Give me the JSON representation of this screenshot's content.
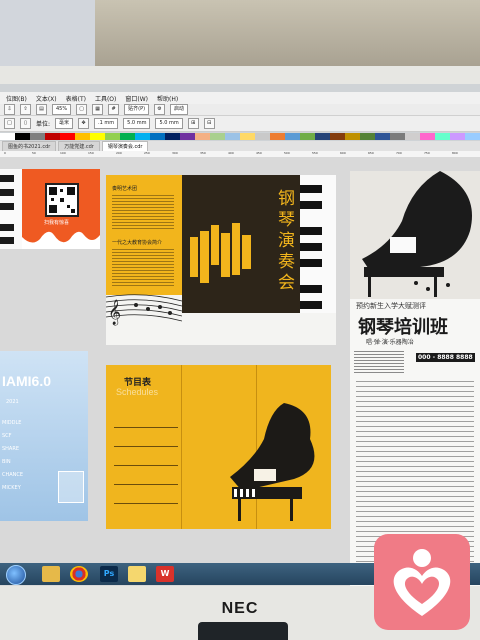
{
  "menu": {
    "items": [
      "位图(B)",
      "文本(X)",
      "表格(T)",
      "工具(O)",
      "窗口(W)",
      "帮助(H)"
    ]
  },
  "toolbar": {
    "zoom": "45%",
    "snap": "贴齐(P)",
    "launch": "启动"
  },
  "propbar": {
    "units_label": "单位:",
    "units": "毫米",
    "nudge": ".1 mm",
    "dup_x": "5.0 mm",
    "dup_y": "5.0 mm"
  },
  "tabs": [
    "图鱼的书2021.cdr",
    "万能党建.cdr",
    "钢琴演奏会.cdr"
  ],
  "active_tab": 2,
  "ruler_ticks": [
    "0",
    "50",
    "100",
    "150",
    "200",
    "250",
    "300",
    "350",
    "400",
    "450",
    "500",
    "550",
    "600",
    "650",
    "700",
    "750",
    "800"
  ],
  "left_panel": {
    "qr_label": "扫我有惊喜",
    "brand": "IAMI6.0",
    "brand_year": "2021",
    "features": [
      "MIDDLE",
      "SCF",
      "SHARE",
      "BIN",
      "CHANCE",
      "MICKEY"
    ]
  },
  "brochure_outer": {
    "intro_heading": "奏明艺术团",
    "music_heading": "一代之大教育协会简介",
    "title": "钢琴演奏会",
    "piano_icon": "piano-keys-icon"
  },
  "brochure_inner": {
    "heading": "节目表",
    "heading_en": "Schedules"
  },
  "flyer": {
    "tagline": "预约新生入学大赋测评",
    "title": "钢琴培训班",
    "subtitle": "唱·弹·演·乐器陶冶",
    "phone": "000 - 8888 8888"
  },
  "colors": {
    "gold": "#f2b51c",
    "dark": "#2d2519",
    "canvas": "#d9d9d9",
    "accent_tab": "#ffffff"
  },
  "taskbar": {
    "icons": [
      "start-orb",
      "folder-icon",
      "chrome-icon",
      "photoshop-icon",
      "paint-icon",
      "wps-icon"
    ]
  },
  "monitor": {
    "brand": "NEC"
  }
}
